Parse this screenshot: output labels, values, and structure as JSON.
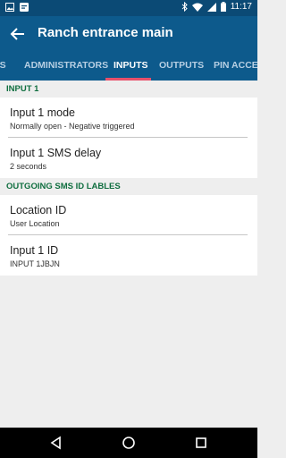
{
  "status_bar": {
    "time": "11:17",
    "icons": [
      "image-icon",
      "notification-icon",
      "bluetooth-icon",
      "wifi-icon",
      "signal-icon",
      "battery-icon"
    ]
  },
  "app_bar": {
    "title": "Ranch entrance main"
  },
  "tabs": [
    {
      "label": "RS",
      "active": false
    },
    {
      "label": "ADMINISTRATORS",
      "active": false
    },
    {
      "label": "INPUTS",
      "active": true
    },
    {
      "label": "OUTPUTS",
      "active": false
    },
    {
      "label": "PIN ACCES",
      "active": false
    }
  ],
  "sections": [
    {
      "header": "INPUT 1",
      "items": [
        {
          "title": "Input 1 mode",
          "value": "Normally open - Negative triggered"
        },
        {
          "title": "Input 1 SMS delay",
          "value": "2 seconds"
        }
      ]
    },
    {
      "header": "OUTGOING SMS ID LABLES",
      "items": [
        {
          "title": "Location ID",
          "value": "User Location"
        },
        {
          "title": "Input 1 ID",
          "value": "INPUT 1JBJN"
        }
      ]
    }
  ],
  "colors": {
    "app_bar": "#0d5a8c",
    "status_bar": "#0b4a75",
    "section_header_text": "#0f6e3f",
    "tab_indicator": "#e8506a"
  }
}
